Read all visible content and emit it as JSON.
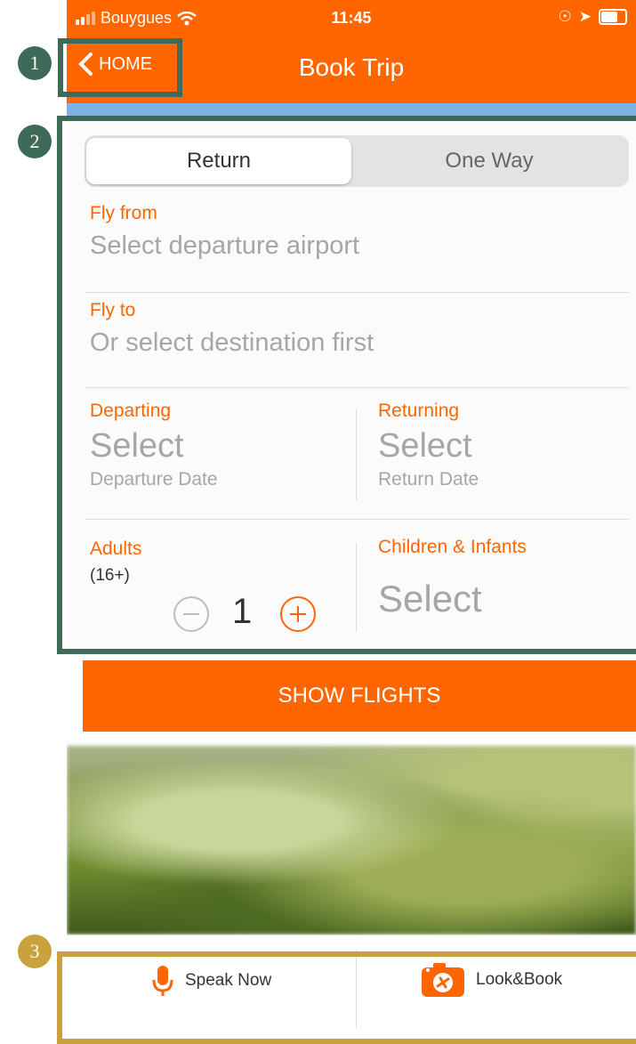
{
  "status_bar": {
    "carrier": "Bouygues",
    "time": "11:45"
  },
  "nav": {
    "back_label": "HOME",
    "title": "Book Trip"
  },
  "trip_type": {
    "options": [
      "Return",
      "One Way"
    ],
    "selected": "Return"
  },
  "fly_from": {
    "label": "Fly from",
    "placeholder": "Select departure airport"
  },
  "fly_to": {
    "label": "Fly to",
    "placeholder": "Or select destination first"
  },
  "departing": {
    "label": "Departing",
    "value": "Select",
    "sub": "Departure Date"
  },
  "returning": {
    "label": "Returning",
    "value": "Select",
    "sub": "Return Date"
  },
  "adults": {
    "label": "Adults",
    "sub": "(16+)",
    "count": "1"
  },
  "children": {
    "label": "Children & Infants",
    "value": "Select"
  },
  "show_flights_label": "SHOW FLIGHTS",
  "bottom_tabs": {
    "speak": "Speak Now",
    "look": "Look&Book"
  },
  "annotations": [
    "1",
    "2",
    "3"
  ],
  "colors": {
    "brand": "#ff6600",
    "annotation_green": "#3e6b57",
    "annotation_gold": "#c9a13d"
  }
}
